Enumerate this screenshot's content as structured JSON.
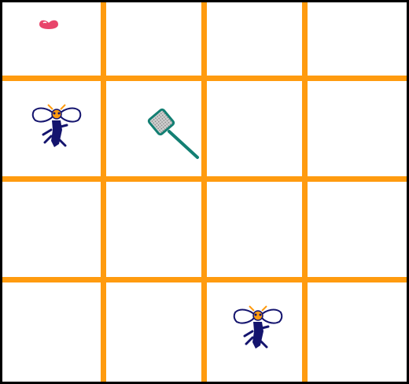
{
  "game": {
    "grid": {
      "rows": 4,
      "cols": 4
    },
    "colors": {
      "grid_line": "#ff9b0f",
      "border": "#000000",
      "cell_background": "#ffffff",
      "swatter": "#137f73",
      "fly_body": "#14146e",
      "fly_accent": "#ff9b0f",
      "heart": "#e8456b"
    },
    "pieces": [
      {
        "name": "heart",
        "icon": "heart-icon",
        "row": 0,
        "col": 0
      },
      {
        "name": "fly",
        "icon": "fly-icon",
        "row": 1,
        "col": 0
      },
      {
        "name": "fly-swatter",
        "icon": "fly-swatter-icon",
        "row": 1,
        "col": 1
      },
      {
        "name": "fly",
        "icon": "fly-icon",
        "row": 3,
        "col": 2
      }
    ]
  }
}
